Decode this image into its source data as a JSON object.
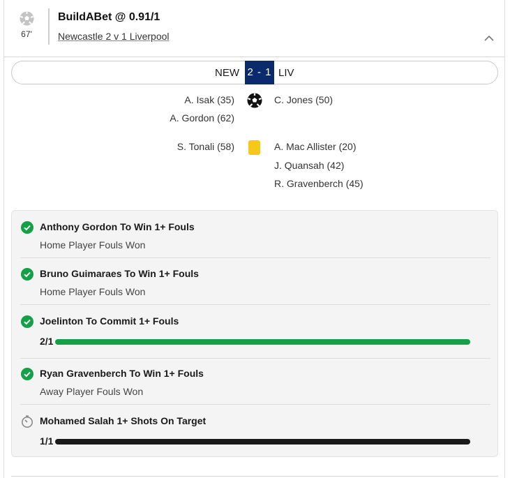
{
  "header": {
    "minute": "67'",
    "bet_title": "BuildABet @ 0.91/1",
    "match_link": "Newcastle 2 v 1 Liverpool"
  },
  "scoreboard": {
    "home": "NEW",
    "score": "2 - 1",
    "away": "LIV"
  },
  "goals": {
    "home": [
      "A. Isak (35)",
      "A. Gordon (62)"
    ],
    "away": [
      "C. Jones (50)"
    ]
  },
  "bookings": {
    "home": [
      "S. Tonali (58)"
    ],
    "away": [
      "A. Mac Allister (20)",
      "J. Quansah (42)",
      "R. Gravenberch (45)"
    ]
  },
  "legs": [
    {
      "title": "Anthony Gordon To Win 1+ Fouls",
      "subtitle": "Home Player Fouls Won",
      "status": "won"
    },
    {
      "title": "Bruno Guimaraes To Win 1+ Fouls",
      "subtitle": "Home Player Fouls Won",
      "status": "won"
    },
    {
      "title": "Joelinton To Commit 1+ Fouls",
      "odds": "2/1",
      "progress": 1.0,
      "status": "won"
    },
    {
      "title": "Ryan Gravenberch To Win 1+ Fouls",
      "subtitle": "Away Player Fouls Won",
      "status": "won"
    },
    {
      "title": "Mohamed Salah 1+ Shots On Target",
      "odds": "1/1",
      "progress": 1.0,
      "status": "pending"
    }
  ],
  "colors": {
    "won": "#13a047",
    "pending_bar": "#1a1a1a",
    "score_bg": "#0b2a6b",
    "yellow_card": "#f6c81a"
  },
  "icons": {
    "minute": "football-icon",
    "goal": "football-icon",
    "booking": "yellow-card-icon",
    "collapse": "chevron-up-icon",
    "won": "check-circle-icon",
    "pending": "stopwatch-icon"
  }
}
